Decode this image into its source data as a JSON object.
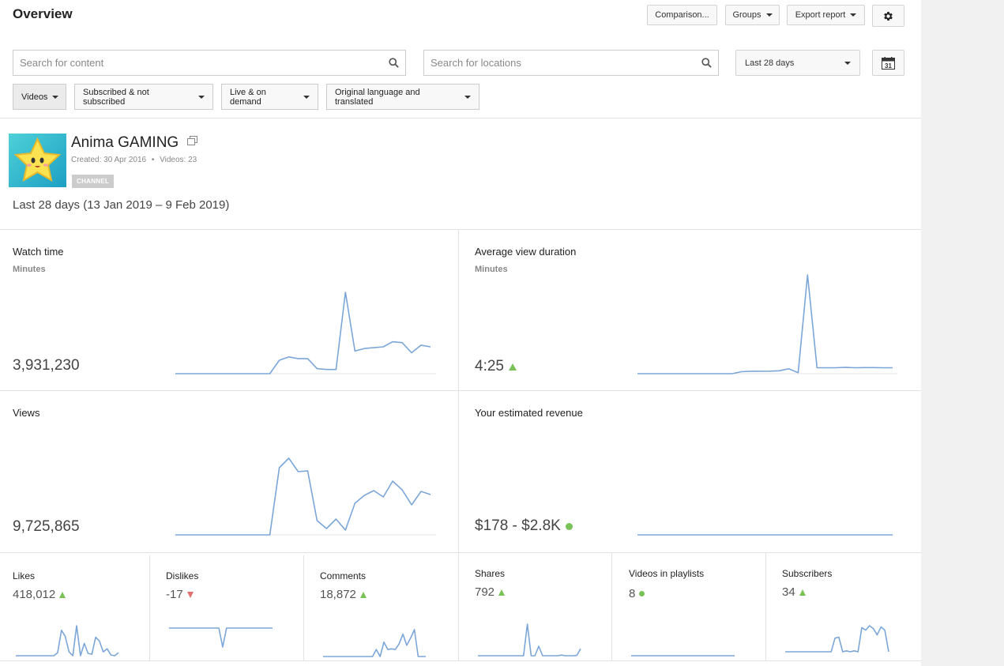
{
  "page": {
    "title": "Overview"
  },
  "toolbar": {
    "comparison": "Comparison...",
    "groups": "Groups",
    "export": "Export report"
  },
  "search": {
    "content_placeholder": "Search for content",
    "locations_placeholder": "Search for locations"
  },
  "date_select": {
    "value": "Last 28 days",
    "calendar_day": "31"
  },
  "filters": [
    {
      "label": "Videos"
    },
    {
      "label": "Subscribed & not subscribed"
    },
    {
      "label": "Live & on demand"
    },
    {
      "label": "Original language and translated"
    }
  ],
  "channel": {
    "name": "Anima GAMING",
    "created": "Created: 30 Apr 2016",
    "videos": "Videos: 23",
    "separator": "•",
    "tag": "CHANNEL",
    "range": "Last 28 days (13 Jan 2019 – 9 Feb 2019)"
  },
  "colors": {
    "line": "#7ba6d8",
    "up": "#78c257",
    "down": "#e07070",
    "neutral": "#78c257"
  },
  "cards": {
    "watch_time": {
      "title": "Watch time",
      "sub": "Minutes",
      "value": "3,931,230",
      "series": [
        0,
        0,
        0,
        0,
        0,
        0,
        0,
        0,
        0,
        0,
        0,
        16,
        20,
        18,
        18,
        6,
        5,
        5,
        97,
        27,
        30,
        31,
        32,
        38,
        37,
        25,
        34,
        32
      ]
    },
    "avg_duration": {
      "title": "Average view duration",
      "sub": "Minutes",
      "value": "4:25",
      "trend": "up",
      "series": [
        0,
        0,
        0,
        0,
        0,
        0,
        0,
        0,
        0,
        0,
        0,
        2,
        2.5,
        2.5,
        2.6,
        3,
        5,
        1,
        100,
        6,
        6,
        6,
        6.5,
        6,
        6.2,
        6.2,
        6,
        6
      ]
    },
    "views": {
      "title": "Views",
      "value": "9,725,865",
      "series": [
        0,
        0,
        0,
        0,
        0,
        0,
        0,
        0,
        0,
        0,
        0,
        85,
        97,
        80,
        81,
        18,
        8,
        20,
        6,
        40,
        50,
        56,
        48,
        68,
        57,
        38,
        55,
        51
      ]
    },
    "revenue": {
      "title": "Your estimated revenue",
      "value": "$178 - $2.8K",
      "trend": "neutral",
      "series": [
        0,
        0,
        0,
        0,
        0,
        0,
        0,
        0,
        0,
        0,
        0,
        0,
        0,
        0,
        0,
        0,
        0,
        0,
        0,
        0,
        0,
        0,
        0,
        0,
        0,
        0,
        0,
        0
      ]
    }
  },
  "metrics": [
    {
      "title": "Likes",
      "value": "418,012",
      "trend": "up",
      "series": [
        0,
        0,
        0,
        0,
        0,
        0,
        0,
        0,
        0,
        0,
        0,
        4,
        33,
        25,
        5,
        0,
        39,
        0,
        16,
        3,
        2,
        24,
        19,
        5,
        9,
        1,
        0,
        4
      ]
    },
    {
      "title": "Dislikes",
      "value": "-17",
      "trend": "down",
      "series": [
        50,
        50,
        50,
        50,
        50,
        50,
        50,
        50,
        50,
        50,
        50,
        50,
        50,
        50,
        0,
        50,
        50,
        50,
        50,
        50,
        50,
        50,
        50,
        50,
        50,
        50,
        50,
        50
      ]
    },
    {
      "title": "Comments",
      "value": "18,872",
      "trend": "up",
      "series": [
        0,
        0,
        0,
        0,
        0,
        0,
        0,
        0,
        0,
        0,
        0,
        0,
        0,
        0,
        22,
        0,
        45,
        22,
        24,
        22,
        40,
        70,
        35,
        57,
        84,
        0,
        0,
        0
      ]
    },
    {
      "title": "Shares",
      "value": "792",
      "trend": "up",
      "series": [
        0,
        0,
        0,
        0,
        0,
        0,
        0,
        0,
        0,
        0,
        0,
        0,
        0,
        100,
        0,
        0,
        30,
        0,
        0,
        0,
        0,
        0,
        2,
        0,
        0,
        0,
        1,
        22
      ]
    },
    {
      "title": "Videos in playlists",
      "value": "8",
      "trend": "neutral",
      "series": [
        0,
        0,
        0,
        0,
        0,
        0,
        0,
        0,
        0,
        0,
        0,
        0,
        0,
        0,
        0,
        0,
        0,
        0,
        0,
        0,
        0,
        0,
        0,
        0,
        0,
        0,
        0,
        0
      ]
    },
    {
      "title": "Subscribers",
      "value": "34",
      "trend": "up",
      "series": [
        0,
        0,
        0,
        0,
        0,
        0,
        0,
        0,
        0,
        0,
        0,
        0,
        0,
        43,
        46,
        0,
        3,
        0,
        3,
        0,
        76,
        68,
        82,
        73,
        53,
        78,
        68,
        0
      ]
    }
  ]
}
